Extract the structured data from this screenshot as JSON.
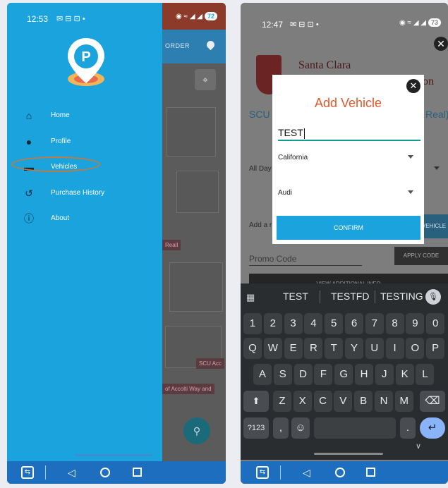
{
  "phone1": {
    "status_time": "12:53",
    "status_icons": "✉ ⊟ ⊡ •",
    "status_right": "◉ ≈ ◢ ◢",
    "battery": "72",
    "map_order_label": "ORDER",
    "map_tag_real": "Reall",
    "map_tag_scu": "SCU Acc",
    "map_tag_way": "of Accolti Way and",
    "menu": [
      {
        "label": "Home",
        "icon": "home-icon"
      },
      {
        "label": "Profile",
        "icon": "person-icon"
      },
      {
        "label": "Vehicles",
        "icon": "car-icon"
      },
      {
        "label": "Purchase History",
        "icon": "history-icon"
      },
      {
        "label": "About",
        "icon": "info-icon"
      }
    ],
    "highlight_color": "#c8783c",
    "drawer_color": "#1ba3dd"
  },
  "phone2": {
    "status_time": "12:47",
    "status_icons": "✉ ⊟ ⊡ •",
    "status_right": "◉ ≈ ◢ ◢",
    "battery": "73",
    "background": {
      "school_name": "Santa Clara",
      "on_fragment": "on",
      "scu_fragment": "SCU",
      "real_fragment": "Real)",
      "all_days_fragment": "All Day",
      "add_fragment": "Add a r",
      "vehicle_button": "VEHICLE",
      "promo_placeholder": "Promo Code",
      "apply_code": "APPLY CODE",
      "view_additional": "VIEW ADDITIONAL INFO"
    },
    "modal": {
      "title": "Add Vehicle",
      "plate_value": "TEST",
      "state_value": "California",
      "make_value": "Audi",
      "confirm_label": "CONFIRM",
      "title_color": "#e4582a",
      "underline_color": "#16998c",
      "confirm_color": "#1ba3dd"
    },
    "keyboard": {
      "suggestions": [
        "TEST",
        "TESTFD",
        "TESTING"
      ],
      "row_numbers": [
        "1",
        "2",
        "3",
        "4",
        "5",
        "6",
        "7",
        "8",
        "9",
        "0"
      ],
      "row_q": [
        "Q",
        "W",
        "E",
        "R",
        "T",
        "Y",
        "U",
        "I",
        "O",
        "P"
      ],
      "row_a": [
        "A",
        "S",
        "D",
        "F",
        "G",
        "H",
        "J",
        "K",
        "L"
      ],
      "row_z": [
        "Z",
        "X",
        "C",
        "V",
        "B",
        "N",
        "M"
      ],
      "shift": "⬆",
      "backspace": "⌫",
      "symbols": "?123",
      "comma": ",",
      "emoji": "☺",
      "period": ".",
      "enter": "↵",
      "down": "∨"
    }
  },
  "navbar": {
    "back": "◁"
  }
}
